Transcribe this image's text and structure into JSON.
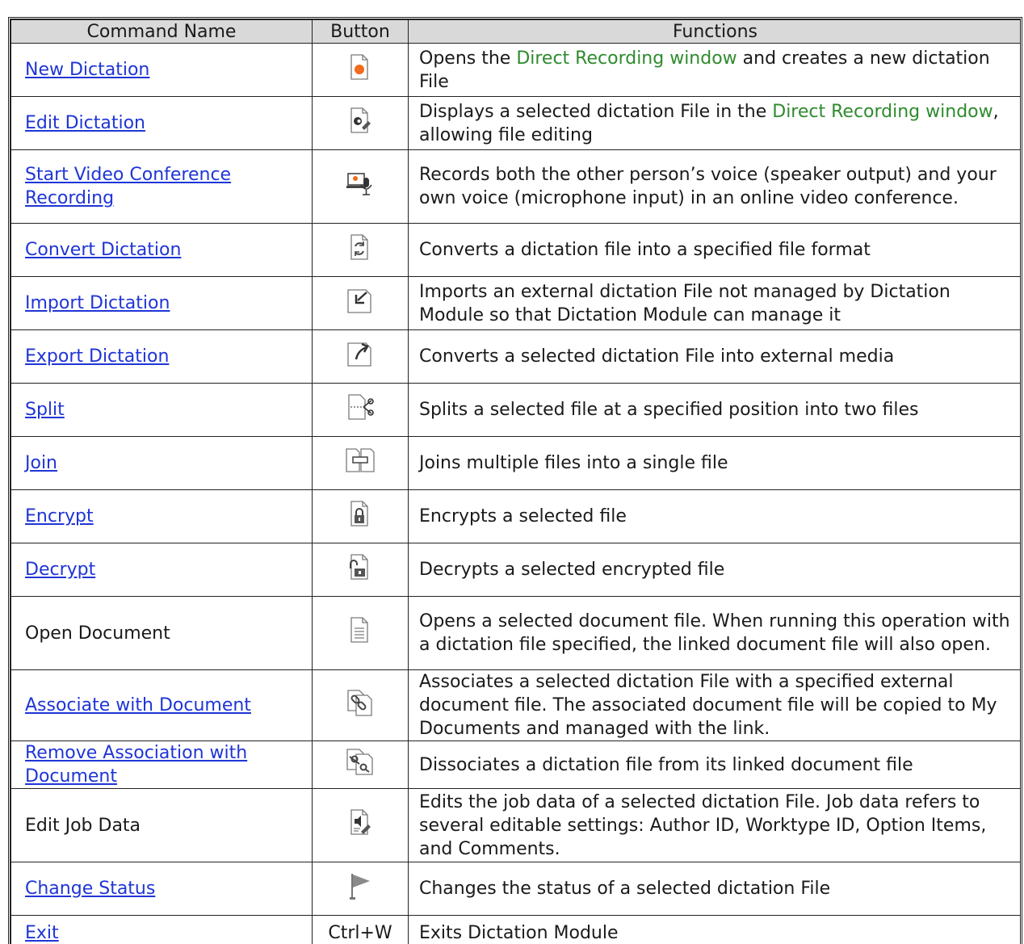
{
  "headers": {
    "command": "Command Name",
    "button": "Button",
    "functions": "Functions"
  },
  "rows": [
    {
      "name": "New Dictation",
      "link": true,
      "icon": "new-dictation-icon",
      "parts": [
        "Opens the ",
        "Direct Recording window",
        " and creates a new dictation File"
      ]
    },
    {
      "name": "Edit Dictation",
      "link": true,
      "icon": "edit-dictation-icon",
      "parts": [
        "Displays a selected dictation File in the ",
        "Direct Recording window",
        ", allowing file editing"
      ]
    },
    {
      "name": "Start Video Conference Recording",
      "link": true,
      "icon": "video-conference-recording-icon",
      "parts": [
        "Records both the other person’s voice (speaker output) and your own voice (microphone input) in an online video conference."
      ]
    },
    {
      "name": "Convert Dictation",
      "link": true,
      "icon": "convert-dictation-icon",
      "parts": [
        "Converts a dictation file into a specified file format"
      ]
    },
    {
      "name": "Import Dictation",
      "link": true,
      "icon": "import-dictation-icon",
      "parts": [
        "Imports an external dictation File not managed by Dictation Module so that Dictation Module can manage it"
      ]
    },
    {
      "name": "Export Dictation",
      "link": true,
      "icon": "export-dictation-icon",
      "parts": [
        "Converts a selected dictation File into external media"
      ]
    },
    {
      "name": "Split",
      "link": true,
      "icon": "split-scissors-icon",
      "parts": [
        "Splits a selected file at a specified position into two files"
      ]
    },
    {
      "name": "Join",
      "link": true,
      "icon": "join-files-icon",
      "parts": [
        "Joins multiple files into a single file"
      ]
    },
    {
      "name": "Encrypt",
      "link": true,
      "icon": "encrypt-lock-icon",
      "parts": [
        "Encrypts a selected file"
      ]
    },
    {
      "name": "Decrypt",
      "link": true,
      "icon": "decrypt-unlock-icon",
      "parts": [
        "Decrypts a selected encrypted file"
      ]
    },
    {
      "name": "Open Document",
      "link": false,
      "icon": "open-document-icon",
      "parts": [
        "Opens a selected document file. When running this operation with a dictation file specified, the linked document file will also open."
      ]
    },
    {
      "name": "Associate with Document",
      "link": true,
      "icon": "associate-link-icon",
      "parts": [
        "Associates a selected dictation File with a specified external document file. The associated document file will be copied to My Documents and managed with the link."
      ]
    },
    {
      "name": "Remove Association with Document",
      "link": true,
      "icon": "remove-association-icon",
      "parts": [
        "Dissociates a dictation file from its linked document file"
      ]
    },
    {
      "name": "Edit Job Data",
      "link": false,
      "icon": "edit-job-data-icon",
      "parts": [
        "Edits the job data of a selected dictation File. Job data refers to several editable settings: Author ID, Worktype ID, Option Items, and Comments."
      ]
    },
    {
      "name": "Change Status",
      "link": true,
      "icon": "change-status-flag-icon",
      "parts": [
        "Changes the status of a selected dictation File"
      ]
    },
    {
      "name": "Exit",
      "link": true,
      "shortcut": "Ctrl+W",
      "parts": [
        "Exits Dictation Module"
      ]
    }
  ],
  "colors": {
    "link": "#1f35d6",
    "highlight": "#2e8b2e",
    "header_bg": "#d9d9d9",
    "record_dot": "#f26a1b"
  }
}
